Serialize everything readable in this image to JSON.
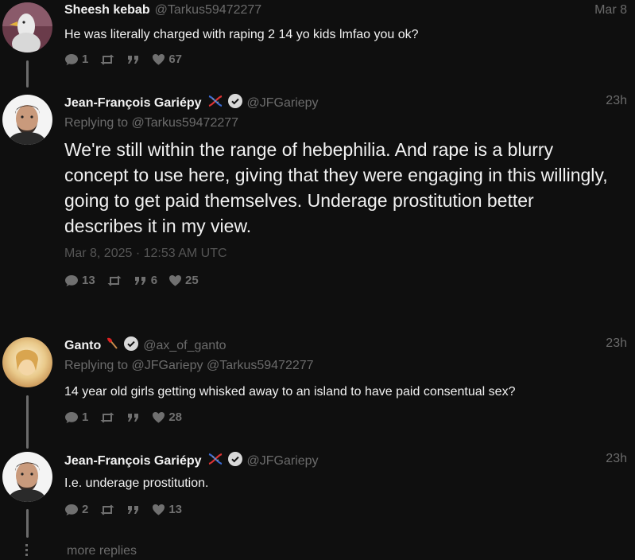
{
  "tweets": [
    {
      "name": "Sheesh kebab",
      "handle": "@Tarkus59472277",
      "time": "Mar 8",
      "reply_to": "",
      "text": "He was literally charged with raping 2 14 yo kids lmfao you ok?",
      "replies": "1",
      "retweets": "",
      "quotes": "",
      "likes": "67"
    },
    {
      "name": "Jean-François Gariépy",
      "handle": "@JFGariepy",
      "time": "23h",
      "reply_to": "Replying to @Tarkus59472277",
      "text": "We're still within the range of hebephilia. And rape is a blurry concept to use here, giving that they were engaging in this willingly, going to get paid themselves. Underage prostitution better describes it in my view.",
      "date": "Mar 8, 2025 · 12:53 AM UTC",
      "replies": "13",
      "retweets": "",
      "quotes": "6",
      "likes": "25"
    },
    {
      "name": "Ganto",
      "handle": "@ax_of_ganto",
      "time": "23h",
      "reply_to": "Replying to @JFGariepy @Tarkus59472277",
      "text": "14 year old girls getting whisked away to an island to have paid consentual sex?",
      "replies": "1",
      "retweets": "",
      "quotes": "",
      "likes": "28"
    },
    {
      "name": "Jean-François Gariépy",
      "handle": "@JFGariepy",
      "time": "23h",
      "reply_to": "",
      "text": "I.e. underage prostitution.",
      "replies": "2",
      "retweets": "",
      "quotes": "",
      "likes": "13"
    }
  ],
  "more_replies": "more replies",
  "colors": {
    "background": "#0f0f0f",
    "muted": "#6b6b6b",
    "text": "#f2f2f2"
  }
}
